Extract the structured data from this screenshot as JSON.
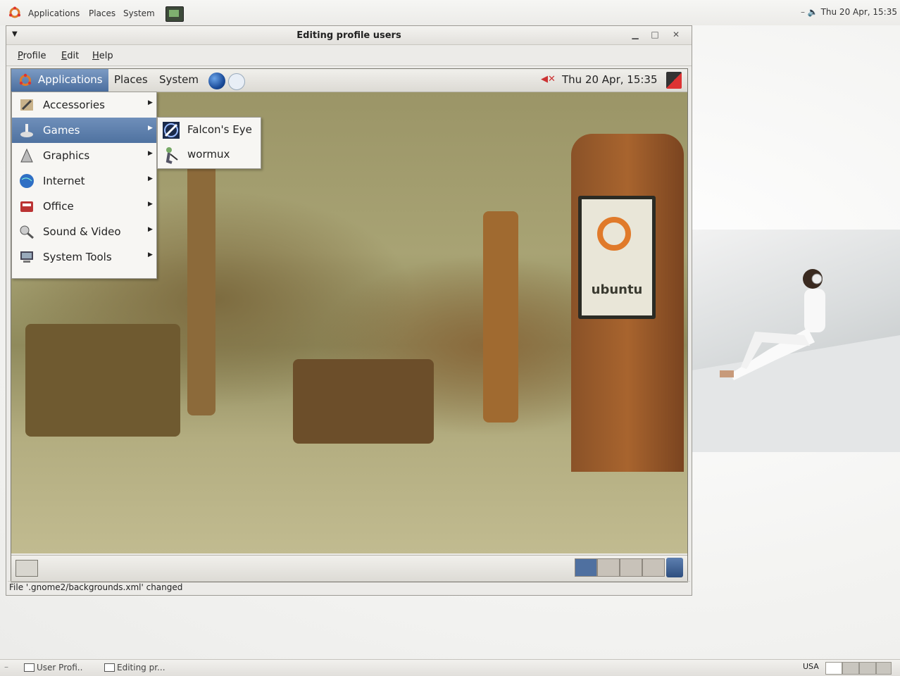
{
  "top_panel": {
    "applications": "Applications",
    "places": "Places",
    "system": "System",
    "clock": "Thu 20 Apr, 15:35"
  },
  "window": {
    "title": "Editing profile users",
    "menu": {
      "profile": "Profile",
      "edit": "Edit",
      "help": "Help"
    },
    "status": "File '.gnome2/backgrounds.xml' changed"
  },
  "preview": {
    "panel": {
      "applications": "Applications",
      "places": "Places",
      "system": "System",
      "clock": "Thu 20 Apr, 15:35"
    },
    "apps_menu": {
      "items": [
        {
          "label": "Accessories",
          "icon": "accessories-icon"
        },
        {
          "label": "Games",
          "icon": "games-icon"
        },
        {
          "label": "Graphics",
          "icon": "graphics-icon"
        },
        {
          "label": "Internet",
          "icon": "internet-icon"
        },
        {
          "label": "Office",
          "icon": "office-icon"
        },
        {
          "label": "Sound & Video",
          "icon": "sound-video-icon"
        },
        {
          "label": "System Tools",
          "icon": "system-tools-icon"
        }
      ],
      "selected_index": 1
    },
    "games_menu": {
      "items": [
        {
          "label": "Falcon's Eye",
          "icon": "falcons-eye-icon"
        },
        {
          "label": "wormux",
          "icon": "wormux-icon"
        }
      ]
    },
    "wallpaper_sign": "ubuntu"
  },
  "taskbar": {
    "tasks": [
      "User Profi..",
      "Editing pr..."
    ],
    "keyboard": "USA"
  },
  "colors": {
    "selection": "#4f72a0",
    "ubuntu_orange": "#e07a2a"
  }
}
